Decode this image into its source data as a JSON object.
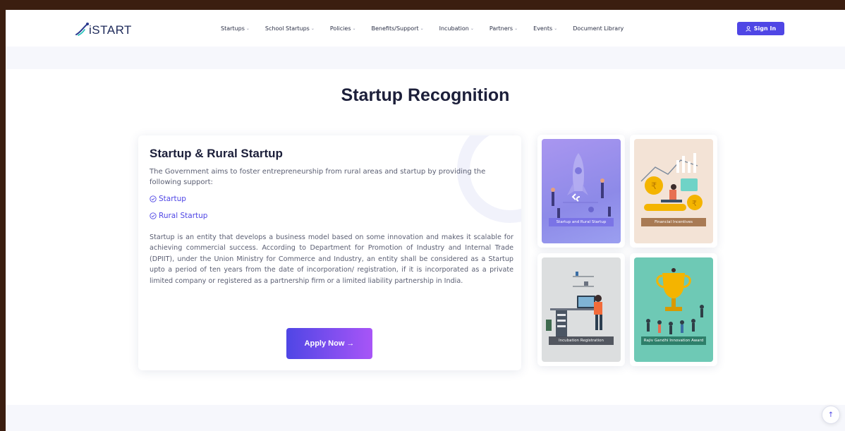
{
  "brand": {
    "name": "iSTART"
  },
  "nav": {
    "items": [
      {
        "label": "Startups",
        "dropdown": true
      },
      {
        "label": "School Startups",
        "dropdown": true
      },
      {
        "label": "Policies",
        "dropdown": true
      },
      {
        "label": "Benefits/Support",
        "dropdown": true
      },
      {
        "label": "Incubation",
        "dropdown": true
      },
      {
        "label": "Partners",
        "dropdown": true
      },
      {
        "label": "Events",
        "dropdown": true
      },
      {
        "label": "Document Library",
        "dropdown": false
      }
    ],
    "signin_label": "Sign In"
  },
  "main": {
    "heading": "Startup Recognition",
    "card": {
      "title": "Startup & Rural Startup",
      "intro": "The Government aims to foster entrepreneurship from rural areas and startup by providing the following support:",
      "links": [
        "Startup",
        "Rural Startup"
      ],
      "body": "Startup is an entity that develops a business model based on some innovation and makes it scalable for achieving commercial success. According to Department for Promotion of Industry and Internal Trade (DPIIT), under the Union Ministry for Commerce and Industry, an entity shall be considered as a Startup upto a period of ten years from the date of incorporation/ registration, if it is incorporated as a private limited company or registered as a partnership firm or a limited liability partnership in India.",
      "apply_label": "Apply Now →"
    },
    "tiles": [
      {
        "label": "Startup and Rural Startup"
      },
      {
        "label": "Financial Incentives"
      },
      {
        "label": "Incubation Registration"
      },
      {
        "label": "Rajiv Gandhi Innovation Award"
      }
    ]
  },
  "colors": {
    "accent": "#4f46e5",
    "accent2": "#a855f7",
    "frame": "#3b1e10"
  }
}
